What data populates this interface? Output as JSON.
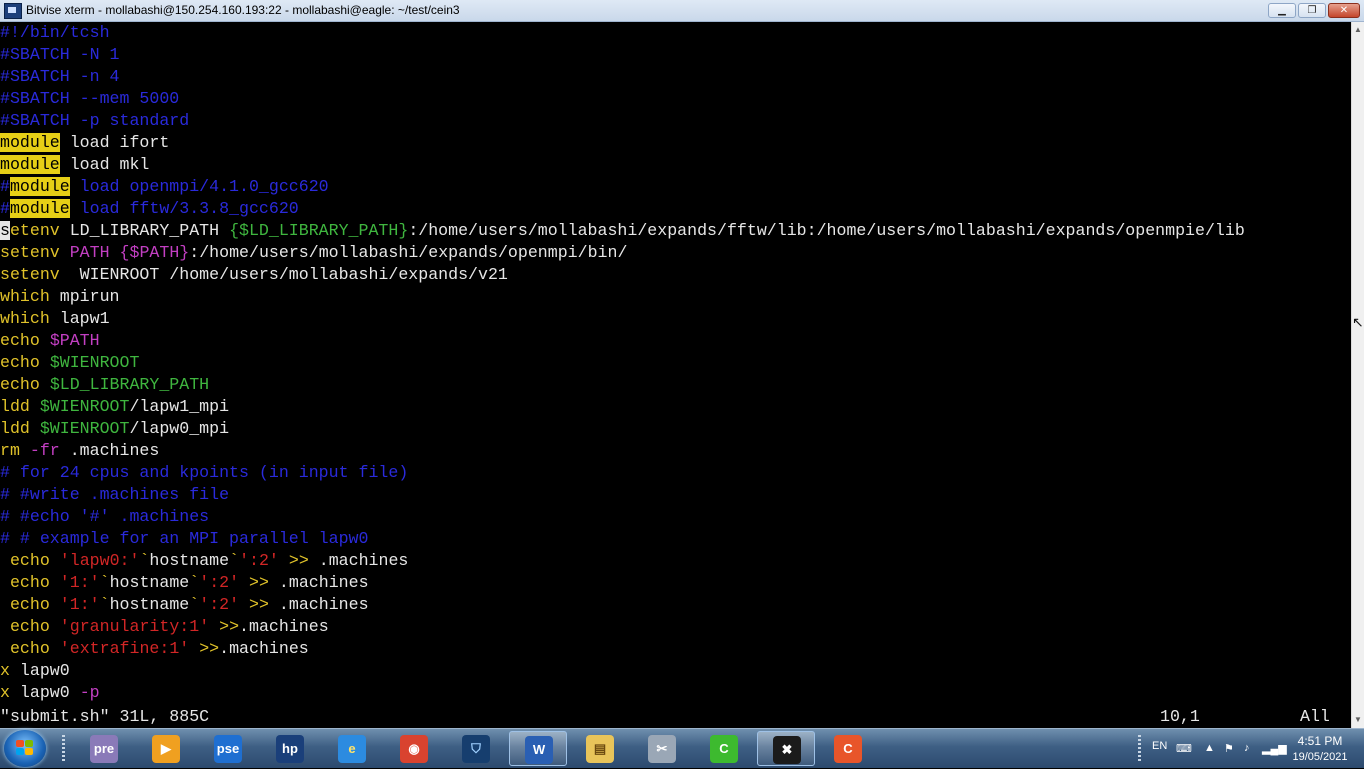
{
  "window": {
    "title": "Bitvise xterm - mollabashi@150.254.160.193:22 - mollabashi@eagle: ~/test/cein3",
    "controls": {
      "minimize": "▁",
      "maximize": "❐",
      "close": "✕"
    }
  },
  "colors": {
    "foreground": "#e6e6e6",
    "comment": "#2a2adb",
    "keyword": "#e0c22a",
    "highlight_bg": "#e6cf16",
    "variable": "#3fb63f",
    "magenta": "#c33fc3",
    "string": "#d22626",
    "status_text": "#e6e6e6"
  },
  "editor": {
    "lines": [
      [
        {
          "t": "#!/bin/tcsh",
          "c": "comment"
        }
      ],
      [
        {
          "t": "#SBATCH -N 1",
          "c": "comment"
        }
      ],
      [
        {
          "t": "#SBATCH -n 4",
          "c": "comment"
        }
      ],
      [
        {
          "t": "#SBATCH --mem 5000",
          "c": "comment"
        }
      ],
      [
        {
          "t": "#SBATCH -p standard",
          "c": "comment"
        }
      ],
      [
        {
          "t": "module",
          "c": "hl"
        },
        {
          "t": " load ifort",
          "c": "fg"
        }
      ],
      [
        {
          "t": "module",
          "c": "hl"
        },
        {
          "t": " load mkl",
          "c": "fg"
        }
      ],
      [
        {
          "t": "#",
          "c": "comment"
        },
        {
          "t": "module",
          "c": "hl"
        },
        {
          "t": " load openmpi/4.1.0_gcc620",
          "c": "comment"
        }
      ],
      [
        {
          "t": "#",
          "c": "comment"
        },
        {
          "t": "module",
          "c": "hl"
        },
        {
          "t": " load fftw/3.3.8_gcc620",
          "c": "comment"
        }
      ],
      [
        {
          "t": "s",
          "c": "cursor"
        },
        {
          "t": "etenv",
          "c": "keyword"
        },
        {
          "t": " LD_LIBRARY_PATH ",
          "c": "fg"
        },
        {
          "t": "{$LD_LIBRARY_PATH}",
          "c": "variable"
        },
        {
          "t": ":/home/users/mollabashi/expands/fftw/lib:/home/users/mollabashi/expands/openmpie/lib",
          "c": "fg"
        }
      ],
      [
        {
          "t": "setenv",
          "c": "keyword"
        },
        {
          "t": " ",
          "c": "fg"
        },
        {
          "t": "PATH",
          "c": "magenta"
        },
        {
          "t": " ",
          "c": "fg"
        },
        {
          "t": "{$PATH}",
          "c": "magenta"
        },
        {
          "t": ":/home/users/mollabashi/expands/openmpi/bin/",
          "c": "fg"
        }
      ],
      [
        {
          "t": "setenv",
          "c": "keyword"
        },
        {
          "t": "  WIENROOT /home/users/mollabashi/expands/v21",
          "c": "fg"
        }
      ],
      [
        {
          "t": "which",
          "c": "keyword"
        },
        {
          "t": " mpirun",
          "c": "fg"
        }
      ],
      [
        {
          "t": "which",
          "c": "keyword"
        },
        {
          "t": " lapw1",
          "c": "fg"
        }
      ],
      [
        {
          "t": "echo",
          "c": "keyword"
        },
        {
          "t": " ",
          "c": "fg"
        },
        {
          "t": "$PATH",
          "c": "magenta"
        }
      ],
      [
        {
          "t": "echo",
          "c": "keyword"
        },
        {
          "t": " ",
          "c": "fg"
        },
        {
          "t": "$WIENROOT",
          "c": "variable"
        }
      ],
      [
        {
          "t": "echo",
          "c": "keyword"
        },
        {
          "t": " ",
          "c": "fg"
        },
        {
          "t": "$LD_LIBRARY_PATH",
          "c": "variable"
        }
      ],
      [
        {
          "t": "ldd",
          "c": "keyword"
        },
        {
          "t": " ",
          "c": "fg"
        },
        {
          "t": "$WIENROOT",
          "c": "variable"
        },
        {
          "t": "/lapw1_mpi",
          "c": "fg"
        }
      ],
      [
        {
          "t": "ldd",
          "c": "keyword"
        },
        {
          "t": " ",
          "c": "fg"
        },
        {
          "t": "$WIENROOT",
          "c": "variable"
        },
        {
          "t": "/lapw0_mpi",
          "c": "fg"
        }
      ],
      [
        {
          "t": "rm",
          "c": "keyword"
        },
        {
          "t": " ",
          "c": "fg"
        },
        {
          "t": "-fr",
          "c": "magenta"
        },
        {
          "t": " .machines",
          "c": "fg"
        }
      ],
      [
        {
          "t": "# for 24 cpus and kpoints (in input file)",
          "c": "comment"
        }
      ],
      [
        {
          "t": "# #write .machines file",
          "c": "comment"
        }
      ],
      [
        {
          "t": "# #echo '#' .machines",
          "c": "comment"
        }
      ],
      [
        {
          "t": "# # example for an MPI parallel lapw0",
          "c": "comment"
        }
      ],
      [
        {
          "t": " ",
          "c": "fg"
        },
        {
          "t": "echo",
          "c": "keyword"
        },
        {
          "t": " ",
          "c": "fg"
        },
        {
          "t": "'lapw0:'",
          "c": "string"
        },
        {
          "t": "`",
          "c": "keyword"
        },
        {
          "t": "hostname",
          "c": "fg"
        },
        {
          "t": "`",
          "c": "keyword"
        },
        {
          "t": "':2'",
          "c": "string"
        },
        {
          "t": " ",
          "c": "fg"
        },
        {
          "t": ">>",
          "c": "keyword"
        },
        {
          "t": " .machines",
          "c": "fg"
        }
      ],
      [
        {
          "t": " ",
          "c": "fg"
        },
        {
          "t": "echo",
          "c": "keyword"
        },
        {
          "t": " ",
          "c": "fg"
        },
        {
          "t": "'1:'",
          "c": "string"
        },
        {
          "t": "`",
          "c": "keyword"
        },
        {
          "t": "hostname",
          "c": "fg"
        },
        {
          "t": "`",
          "c": "keyword"
        },
        {
          "t": "':2'",
          "c": "string"
        },
        {
          "t": " ",
          "c": "fg"
        },
        {
          "t": ">>",
          "c": "keyword"
        },
        {
          "t": " .machines",
          "c": "fg"
        }
      ],
      [
        {
          "t": " ",
          "c": "fg"
        },
        {
          "t": "echo",
          "c": "keyword"
        },
        {
          "t": " ",
          "c": "fg"
        },
        {
          "t": "'1:'",
          "c": "string"
        },
        {
          "t": "`",
          "c": "keyword"
        },
        {
          "t": "hostname",
          "c": "fg"
        },
        {
          "t": "`",
          "c": "keyword"
        },
        {
          "t": "':2'",
          "c": "string"
        },
        {
          "t": " ",
          "c": "fg"
        },
        {
          "t": ">>",
          "c": "keyword"
        },
        {
          "t": " .machines",
          "c": "fg"
        }
      ],
      [
        {
          "t": " ",
          "c": "fg"
        },
        {
          "t": "echo",
          "c": "keyword"
        },
        {
          "t": " ",
          "c": "fg"
        },
        {
          "t": "'granularity:1'",
          "c": "string"
        },
        {
          "t": " ",
          "c": "fg"
        },
        {
          "t": ">>",
          "c": "keyword"
        },
        {
          "t": ".machines",
          "c": "fg"
        }
      ],
      [
        {
          "t": " ",
          "c": "fg"
        },
        {
          "t": "echo",
          "c": "keyword"
        },
        {
          "t": " ",
          "c": "fg"
        },
        {
          "t": "'extrafine:1'",
          "c": "string"
        },
        {
          "t": " ",
          "c": "fg"
        },
        {
          "t": ">>",
          "c": "keyword"
        },
        {
          "t": ".machines",
          "c": "fg"
        }
      ],
      [
        {
          "t": "x",
          "c": "keyword"
        },
        {
          "t": " lapw0",
          "c": "fg"
        }
      ],
      [
        {
          "t": "x",
          "c": "keyword"
        },
        {
          "t": " lapw0 ",
          "c": "fg"
        },
        {
          "t": "-p",
          "c": "magenta"
        }
      ]
    ],
    "status": {
      "file_info": "\"submit.sh\" 31L, 885C",
      "position": "10,1",
      "scroll": "All"
    }
  },
  "taskbar": {
    "items": [
      {
        "name": "pre-app",
        "label": "pre",
        "bg": "#8a7ab8",
        "fg": "#ffffff",
        "active": false
      },
      {
        "name": "media-player",
        "label": "▶",
        "bg": "#f0a020",
        "fg": "#ffffff",
        "active": false
      },
      {
        "name": "pse-app",
        "label": "pse",
        "bg": "#1f6fd1",
        "fg": "#ffffff",
        "active": false
      },
      {
        "name": "hp-app",
        "label": "hp",
        "bg": "#1a3f7a",
        "fg": "#ffffff",
        "active": false
      },
      {
        "name": "internet-explorer",
        "label": "e",
        "bg": "#2c8be0",
        "fg": "#ffe36b",
        "active": false
      },
      {
        "name": "chrome",
        "label": "◉",
        "bg": "#d9432f",
        "fg": "#ffffff",
        "active": false
      },
      {
        "name": "vpn-shield",
        "label": "⛉",
        "bg": "#163e6e",
        "fg": "#9fd0ff",
        "active": false
      },
      {
        "name": "word",
        "label": "W",
        "bg": "#2a5fb3",
        "fg": "#ffffff",
        "active": true
      },
      {
        "name": "file-explorer",
        "label": "▤",
        "bg": "#e8c45a",
        "fg": "#6b4a10",
        "active": false
      },
      {
        "name": "tools",
        "label": "✂",
        "bg": "#9aa7b6",
        "fg": "#ffffff",
        "active": false
      },
      {
        "name": "camtasia-green",
        "label": "C",
        "bg": "#3dba2f",
        "fg": "#ffffff",
        "active": false
      },
      {
        "name": "xterm",
        "label": "✖",
        "bg": "#1b1b1b",
        "fg": "#ffffff",
        "active": true
      },
      {
        "name": "camtasia-orange",
        "label": "C",
        "bg": "#e8552a",
        "fg": "#ffffff",
        "active": false
      }
    ],
    "tray": {
      "language": "EN",
      "icons": [
        "keyboard-icon",
        "arrow-up-icon",
        "flag-icon",
        "network-icon"
      ],
      "time": "4:51 PM",
      "date": "19/05/2021"
    }
  }
}
